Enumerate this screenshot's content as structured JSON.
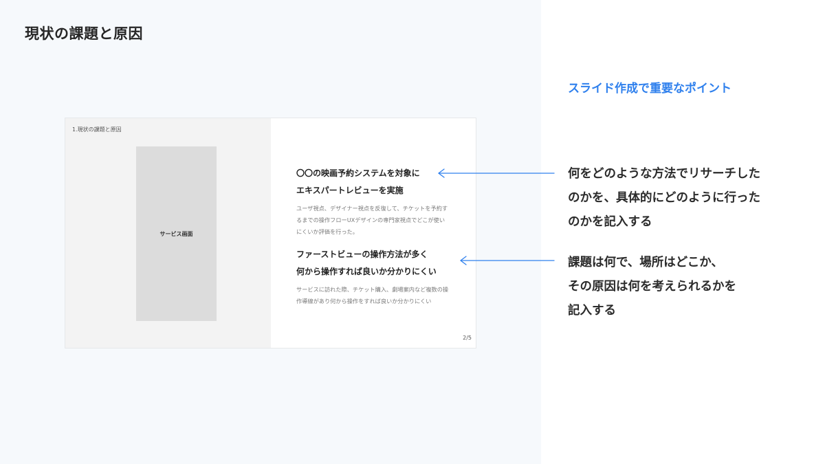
{
  "page": {
    "title": "現状の課題と原因"
  },
  "slide": {
    "breadcrumb": "1.現状の課題と原因",
    "screen_placeholder_label": "サービス画面",
    "findings": [
      {
        "heading_lines": [
          "〇〇の映画予約システムを対象に",
          "エキスパートレビューを実施"
        ],
        "body_lines": [
          "ユーザ視点、デザイナー視点を反復して、チケットを予約す",
          "るまでの操作フローUXデザインの専門家視点でどこが使い",
          "にくいか評価を行った。"
        ]
      },
      {
        "heading_lines": [
          "ファーストビューの操作方法が多く",
          "何から操作すれば良いか分かりにくい"
        ],
        "body_lines": [
          "サービスに訪れた際、チケット購入、劇場案内など複数の操",
          "作導線があり何から操作をすれば良いか分かりにくい"
        ]
      }
    ],
    "page_number": "2/5"
  },
  "points": {
    "heading": "スライド作成で重要なポイント",
    "notes": [
      {
        "lines": [
          "何をどのような方法でリサーチした",
          "のかを、具体的にどのように行った",
          "のかを記入する"
        ]
      },
      {
        "lines": [
          "課題は何で、場所はどこか、",
          "その原因は何を考えられるかを",
          "記入する"
        ]
      }
    ]
  },
  "colors": {
    "accent": "#2f80ed",
    "left_background": "#f6f9fc",
    "placeholder": "#dcdcdc"
  }
}
